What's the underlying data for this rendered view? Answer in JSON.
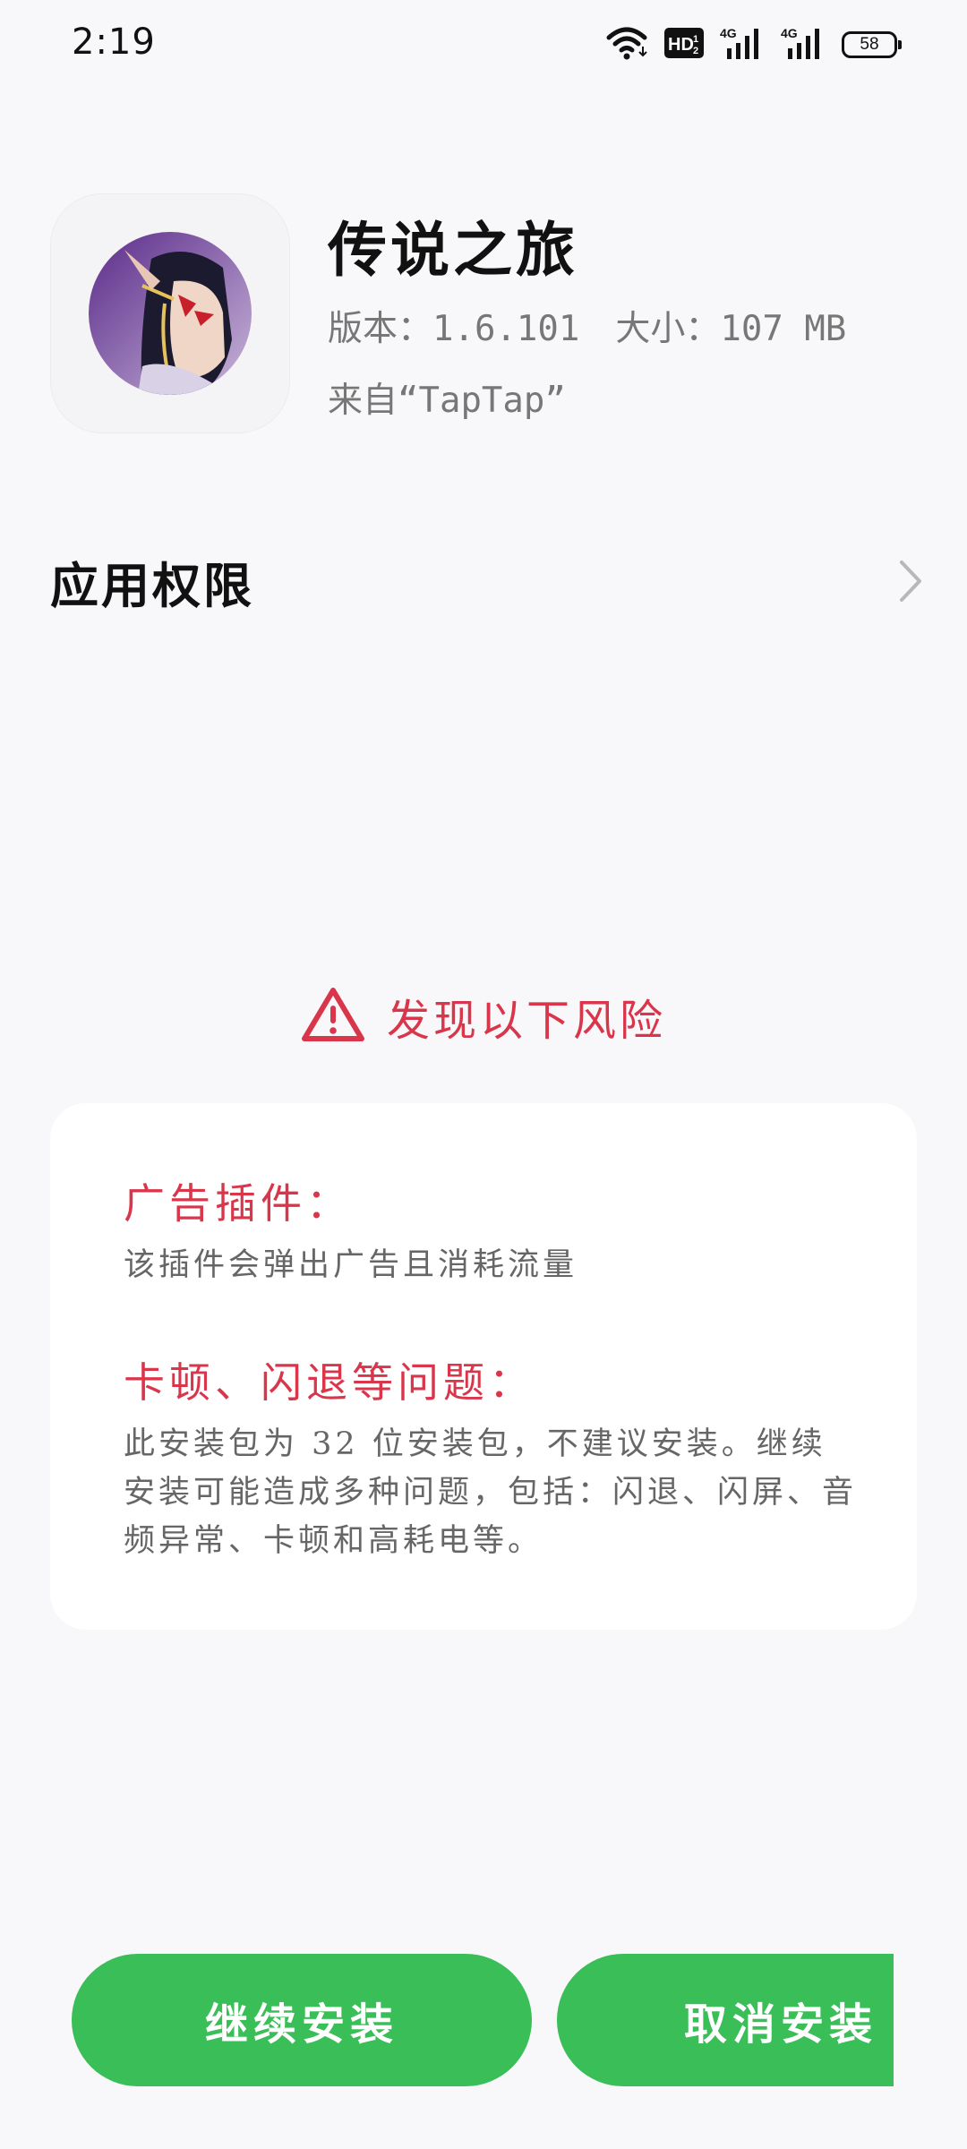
{
  "status_bar": {
    "time": "2:19",
    "network_1": "4G",
    "network_2": "4G",
    "hd_badge": "HD",
    "battery_level": "58",
    "icons": [
      "wifi-icon",
      "hd-icon",
      "signal-4g-icon",
      "signal-4g-icon",
      "battery-icon"
    ]
  },
  "app": {
    "name": "传说之旅",
    "version_label": "版本：",
    "version": "1.6.101",
    "size_label": "大小：",
    "size": "107 MB",
    "source": "来自“TapTap”",
    "icon": "app-avatar-icon"
  },
  "permissions": {
    "label": "应用权限",
    "icon": "chevron-right-icon"
  },
  "risk": {
    "heading": "发现以下风险",
    "heading_icon": "warning-icon",
    "color": "#d9364b",
    "items": [
      {
        "title": "广告插件：",
        "description": "该插件会弹出广告且消耗流量"
      },
      {
        "title": "卡顿、闪退等问题：",
        "description": "此安装包为 32 位安装包，不建议安装。继续安装可能造成多种问题，包括：闪退、闪屏、音频异常、卡顿和高耗电等。"
      }
    ]
  },
  "buttons": {
    "continue": "继续安装",
    "cancel": "取消安装",
    "color": "#3abe58"
  }
}
